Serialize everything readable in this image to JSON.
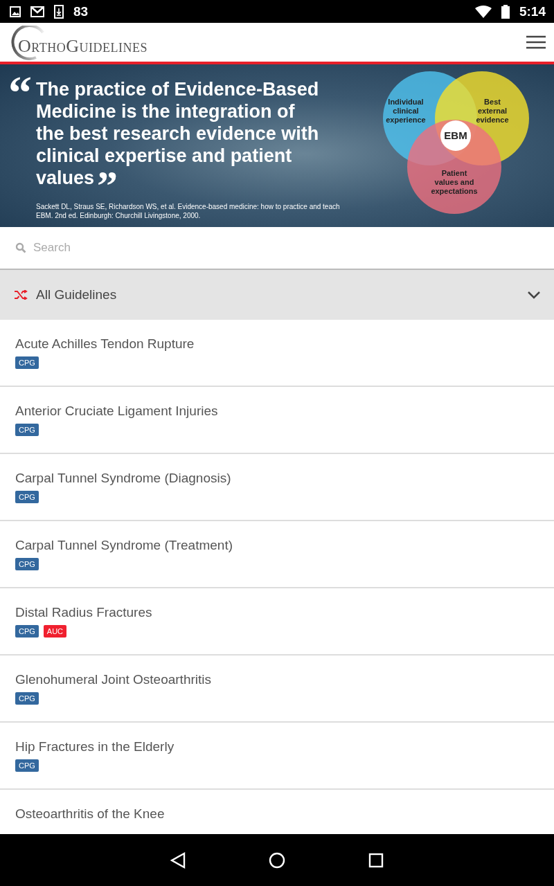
{
  "status_bar": {
    "notification_count": "83",
    "time": "5:14"
  },
  "header": {
    "logo": "OrthoGuidelines"
  },
  "banner": {
    "quote": "The practice of Evidence-Based Medicine is the integration of the best research evidence with clinical expertise and patient values",
    "open_mark": "“",
    "close_mark": "”",
    "citation": "Sackett DL, Straus SE, Richardson WS, et al. Evidence-based medicine: how to practice and teach EBM. 2nd ed. Edinburgh: Churchill Livingstone, 2000.",
    "venn": [
      {
        "lines": [
          "Individual",
          "clinical",
          "experience"
        ]
      },
      {
        "lines": [
          "Best",
          "external",
          "evidence"
        ]
      },
      {
        "lines": [
          "Patient",
          "values and",
          "expectations"
        ]
      }
    ],
    "venn_center": "EBM"
  },
  "search": {
    "placeholder": "Search"
  },
  "filter": {
    "label": "All Guidelines",
    "expanded": false
  },
  "guidelines": [
    {
      "title": "Acute Achilles Tendon Rupture",
      "tags": [
        {
          "label": "CPG",
          "kind": "cpg"
        }
      ]
    },
    {
      "title": "Anterior Cruciate Ligament Injuries",
      "tags": [
        {
          "label": "CPG",
          "kind": "cpg"
        }
      ]
    },
    {
      "title": "Carpal Tunnel Syndrome (Diagnosis)",
      "tags": [
        {
          "label": "CPG",
          "kind": "cpg"
        }
      ]
    },
    {
      "title": "Carpal Tunnel Syndrome (Treatment)",
      "tags": [
        {
          "label": "CPG",
          "kind": "cpg"
        }
      ]
    },
    {
      "title": "Distal Radius Fractures",
      "tags": [
        {
          "label": "CPG",
          "kind": "cpg"
        },
        {
          "label": "AUC",
          "kind": "auc"
        }
      ]
    },
    {
      "title": "Glenohumeral Joint Osteoarthritis",
      "tags": [
        {
          "label": "CPG",
          "kind": "cpg"
        }
      ]
    },
    {
      "title": "Hip Fractures in the Elderly",
      "tags": [
        {
          "label": "CPG",
          "kind": "cpg"
        }
      ]
    },
    {
      "title": "Osteoarthritis of the Knee"
    }
  ]
}
